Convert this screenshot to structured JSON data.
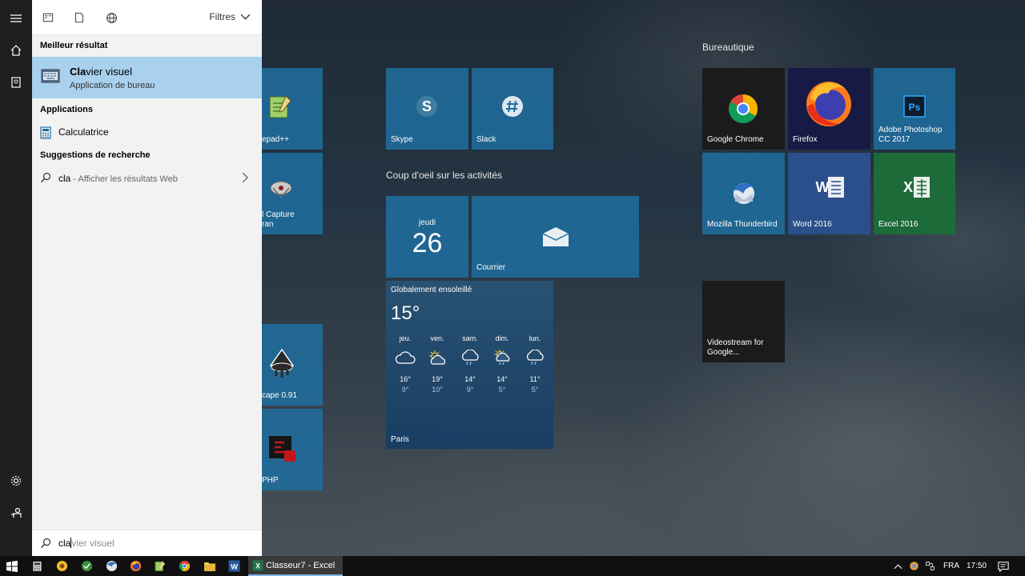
{
  "search_panel": {
    "filters_label": "Filtres",
    "best_match": {
      "section": "Meilleur résultat",
      "name_match": "Cla",
      "name_rest": "vier visuel",
      "subtitle": "Application de bureau"
    },
    "apps": {
      "section": "Applications",
      "items": [
        {
          "label": "Calculatrice"
        }
      ]
    },
    "suggestions": {
      "section": "Suggestions de recherche",
      "query": "cla",
      "hint": " - Afficher les résultats Web"
    },
    "search_box": {
      "typed": "cla",
      "autocomplete": "vier visuel"
    }
  },
  "start_tiles": {
    "partial": [
      {
        "label": "epad++"
      },
      {
        "label": "l Capture\nran"
      },
      {
        "label": "cape 0.91"
      },
      {
        "label": "PHP"
      }
    ],
    "main": [
      {
        "label": "Skype"
      },
      {
        "label": "Slack"
      }
    ],
    "activity_group": "Coup d'oeil sur les activités",
    "calendar": {
      "day_name": "jeudi",
      "day_num": "26"
    },
    "mail": {
      "label": "Courrier"
    },
    "weather": {
      "desc": "Globalement ensoleillé",
      "temp": "15°",
      "city": "Paris",
      "days": [
        {
          "name": "jeu.",
          "hi": "16°",
          "lo": "9°",
          "icon": "cloud-icon"
        },
        {
          "name": "ven.",
          "hi": "19°",
          "lo": "10°",
          "icon": "partly-sunny-icon"
        },
        {
          "name": "sam.",
          "hi": "14°",
          "lo": "9°",
          "icon": "rain-icon"
        },
        {
          "name": "dim.",
          "hi": "14°",
          "lo": "5°",
          "icon": "sun-rain-icon"
        },
        {
          "name": "lun.",
          "hi": "11°",
          "lo": "5°",
          "icon": "rain-icon"
        }
      ]
    },
    "office_group": "Bureautique",
    "office": [
      {
        "label": "Google Chrome"
      },
      {
        "label": "Firefox"
      },
      {
        "label": "Adobe Photoshop\nCC 2017"
      },
      {
        "label": "Mozilla Thunderbird"
      },
      {
        "label": "Word 2016"
      },
      {
        "label": "Excel 2016"
      }
    ],
    "videostream": {
      "label": "Videostream for\nGoogle..."
    }
  },
  "taskbar": {
    "active_window": "Classeur7 - Excel",
    "language": "FRA",
    "clock": "17:50"
  },
  "colors": {
    "accent": "#1e6ea0",
    "selected": "#a9d1ee",
    "word": "#2b4f8a",
    "excel": "#1e6b3a",
    "dark_tile": "#1b1b1b"
  }
}
